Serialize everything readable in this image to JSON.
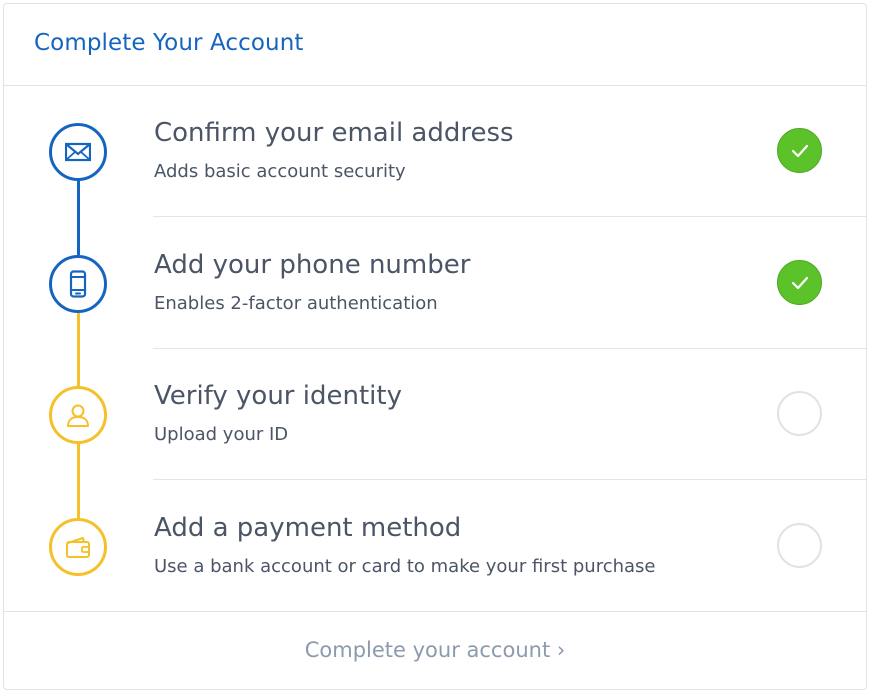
{
  "card": {
    "title": "Complete Your Account",
    "footer_link": "Complete your account ›"
  },
  "steps": [
    {
      "icon": "envelope-icon",
      "title": "Confirm your email address",
      "subtitle": "Adds basic account security",
      "completed": true
    },
    {
      "icon": "phone-icon",
      "title": "Add your phone number",
      "subtitle": "Enables 2-factor authentication",
      "completed": true
    },
    {
      "icon": "user-icon",
      "title": "Verify your identity",
      "subtitle": "Upload your ID",
      "completed": false
    },
    {
      "icon": "wallet-icon",
      "title": "Add a payment method",
      "subtitle": "Use a bank account or card to make your first purchase",
      "completed": false
    }
  ],
  "colors": {
    "accent_blue": "#1565c0",
    "pending_yellow": "#f4c12a",
    "success_green": "#5cc22a",
    "text": "#4b5566",
    "muted_link": "#8c9aae"
  }
}
